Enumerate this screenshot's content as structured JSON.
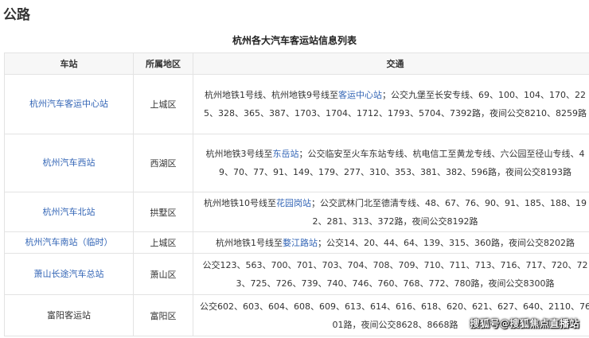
{
  "section_heading": "公路",
  "table_caption": "杭州各大汽车客运站信息列表",
  "headers": {
    "station": "车站",
    "district": "所属地区",
    "transport": "交通"
  },
  "rows": [
    {
      "station": "杭州汽车客运中心站",
      "district": "上城区",
      "transport_prefix": "杭州地铁1号线、杭州地铁9号线至",
      "transport_link": "客运中心站",
      "transport_suffix": "；公交九堡至长安专线、69、100、104、170、225、328、365、387、1703、1704、1712、1793、5704、7392路，夜间公交8210、8259路"
    },
    {
      "station": "杭州汽车西站",
      "district": "西湖区",
      "transport_prefix": "杭州地铁3号线至",
      "transport_link": "东岳站",
      "transport_suffix": "；公交临安至火车东站专线、杭电信工至黄龙专线、六公园至径山专线、49、70、77、91、149、179、277、310、353、381、382、596路，夜间公交8193路"
    },
    {
      "station": "杭州汽车北站",
      "district": "拱墅区",
      "transport_prefix": "杭州地铁10号线至",
      "transport_link": "花园岗站",
      "transport_suffix": "；公交武林门北至德清专线、48、67、76、90、91、185、188、192、281、313、372路，夜间公交8192路"
    },
    {
      "station": "杭州汽车南站（临时）",
      "district": "上城区",
      "transport_prefix": "杭州地铁1号线至",
      "transport_link": "婺江路站",
      "transport_suffix": "；公交14、20、44、64、139、315、360路，夜间公交8202路"
    },
    {
      "station": "萧山长途汽车总站",
      "district": "萧山区",
      "transport_prefix": "公交123、563、700、701、703、704、708、709、710、711、713、716、717、720、723、725、726、739、740、746、760、768、772、780路，夜间公交8300路",
      "transport_link": "",
      "transport_suffix": ""
    },
    {
      "station": "富阳客运站",
      "district": "富阳区",
      "transport_prefix": "公交602、603、604、608、609、613、614、616、618、620、621、627、640、2110、7601路，夜间公交8628、8668路",
      "transport_link": "",
      "transport_suffix": ""
    }
  ],
  "watermark": "搜狐号@搜狐焦点直播站"
}
